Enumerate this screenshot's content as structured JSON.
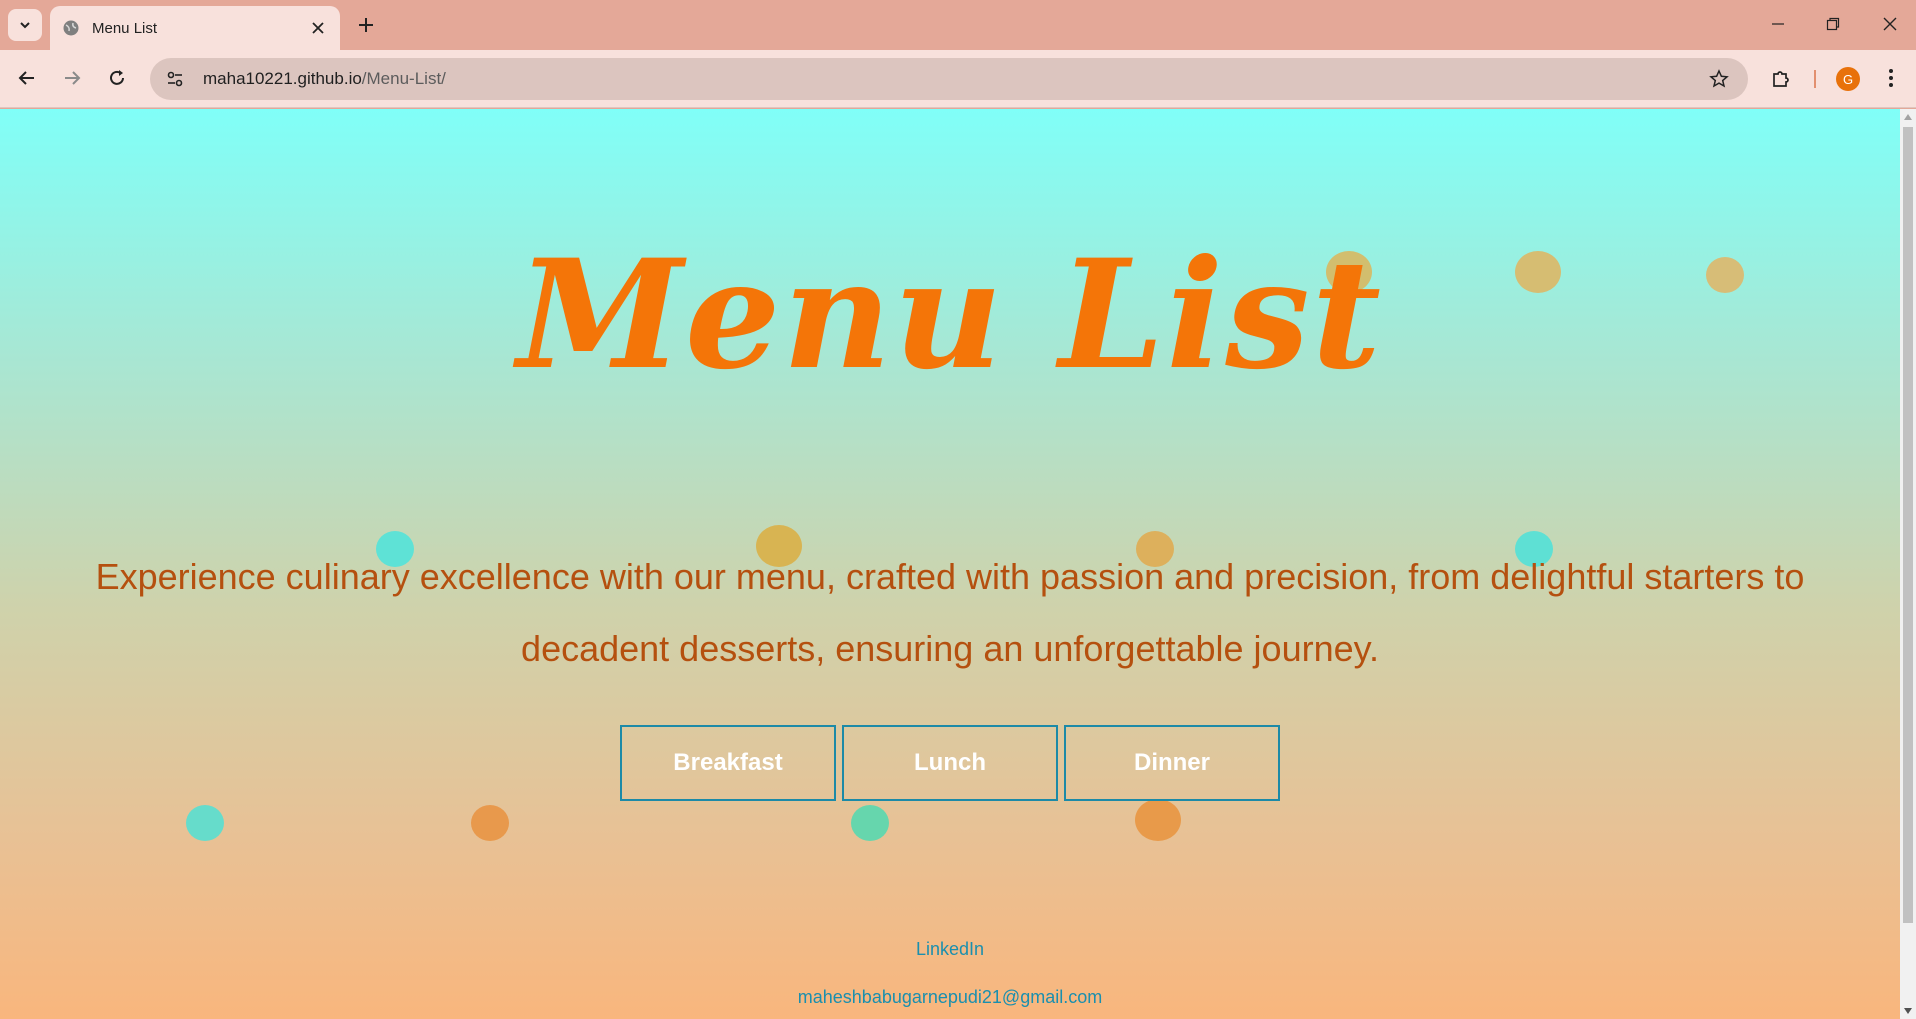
{
  "browser": {
    "tab_title": "Menu List",
    "url_host": "maha10221.github.io",
    "url_path": "/Menu-List/",
    "profile_initial": "G"
  },
  "page": {
    "title": "Menu List",
    "tagline": "Experience culinary excellence with our menu, crafted with passion and precision, from delightful starters to decadent desserts, ensuring an unforgettable journey.",
    "buttons": [
      "Breakfast",
      "Lunch",
      "Dinner"
    ],
    "footer": {
      "linkedin": "LinkedIn",
      "email": "maheshbabugarnepudi21@gmail.com"
    }
  },
  "colors": {
    "title": "#f47508",
    "tagline": "#b5500f",
    "button_border": "#1c8aa7",
    "link": "#1a8fae",
    "gradient_top": "#80fff8",
    "gradient_bottom": "#f9b67d"
  }
}
